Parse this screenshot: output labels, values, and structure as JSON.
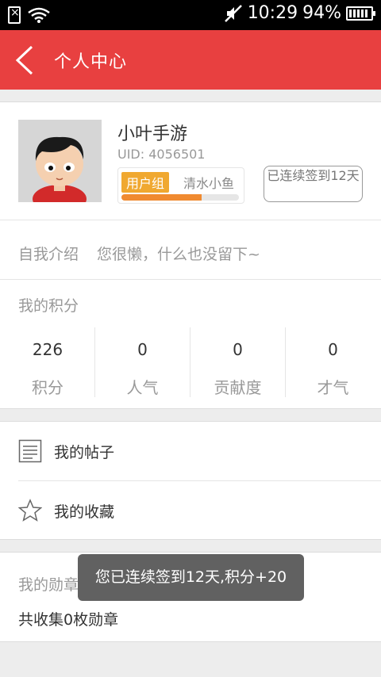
{
  "status_bar": {
    "time": "10:29",
    "battery_percent": "94%",
    "icons": [
      "sim-icon",
      "wifi-icon",
      "mute-icon",
      "battery-icon"
    ]
  },
  "header": {
    "title": "个人中心",
    "back_icon": "back-chevron-icon",
    "bg_color": "#e84040"
  },
  "profile": {
    "username": "小叶手游",
    "uid": "UID: 4056501",
    "group_tag": "用户组",
    "group_name": "清水小鱼",
    "level_progress": 0.68,
    "checkin_button": "已连续签到12天"
  },
  "intro": {
    "label": "自我介绍",
    "text": "您很懒，什么也没留下~"
  },
  "points": {
    "title": "我的积分",
    "stats": [
      {
        "value": "226",
        "label": "积分"
      },
      {
        "value": "0",
        "label": "人气"
      },
      {
        "value": "0",
        "label": "贡献度"
      },
      {
        "value": "0",
        "label": "才气"
      }
    ]
  },
  "menu": {
    "items": [
      {
        "label": "我的帖子",
        "icon": "document-icon"
      },
      {
        "label": "我的收藏",
        "icon": "star-icon"
      }
    ]
  },
  "medals": {
    "title": "我的勋章",
    "count_text": "共收集0枚勋章"
  },
  "toast": {
    "message": "您已连续签到12天,积分+20"
  }
}
